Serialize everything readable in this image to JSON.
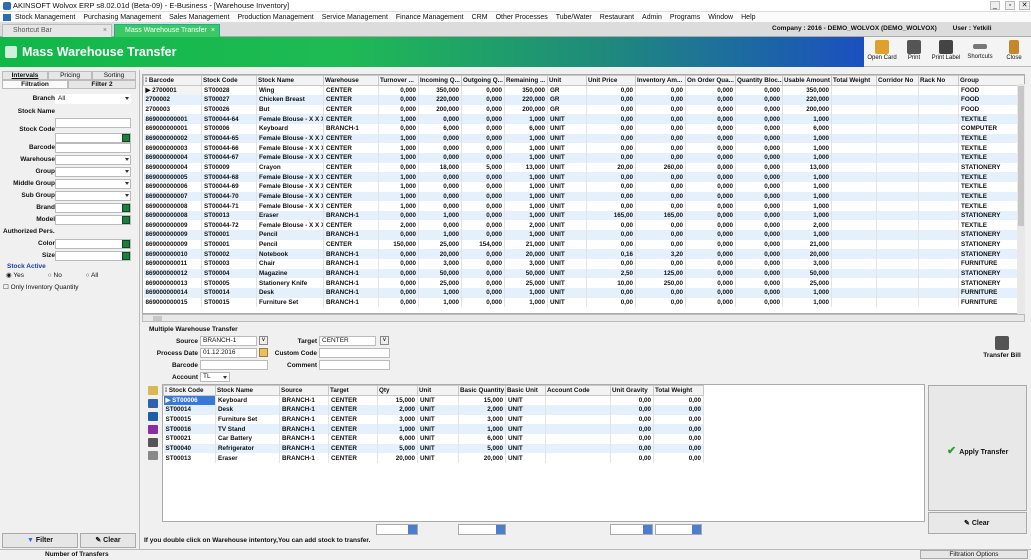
{
  "window": {
    "title": "AKINSOFT Wolvox ERP  s8.02.01d (Beta-09)  -  E-Business  -  [Warehouse Inventory]"
  },
  "menu": [
    "Stock Management",
    "Purchasing Management",
    "Sales Management",
    "Production Management",
    "Service Management",
    "Finance Management",
    "CRM",
    "Other Processes",
    "Tube/Water",
    "Restaurant",
    "Admin",
    "Programs",
    "Window",
    "Help"
  ],
  "tabs": {
    "shortcut": "Shortcut Bar",
    "active": "Mass Warehouse Transfer"
  },
  "company": {
    "label": "Company : 2016 - DEMO_WOLVOX (DEMO_WOLVOX)",
    "user": "User : Yetkili"
  },
  "header": {
    "title": "Mass Warehouse Transfer"
  },
  "toolbar": {
    "open_card": "Open Card",
    "print": "Print",
    "print_label": "Print Label",
    "shortcuts": "Shortcuts",
    "close": "Close"
  },
  "left": {
    "tab_intervals": "Intervals",
    "tab_pricing": "Pricing",
    "tab_sorting": "Sorting",
    "tab_filtration": "Filtration",
    "tab_filter2": "Filter 2",
    "branch_label": "Branch",
    "branch_value": "All",
    "stock_name": "Stock Name",
    "stock_code": "Stock Code",
    "barcode": "Barcode",
    "warehouse": "Warehouse",
    "group": "Group",
    "middle_group": "Middle Group",
    "sub_group": "Sub Group",
    "brand": "Brand",
    "model": "Model",
    "authorized": "Authorized Pers.",
    "color": "Color",
    "size": "Size",
    "stock_active": "Stock Active",
    "yes": "Yes",
    "no": "No",
    "all": "All",
    "only_inventory": "Only Inventory Quantity",
    "filter_btn": "Filter",
    "clear_btn": "Clear"
  },
  "grid1": {
    "headers": [
      "Barcode",
      "Stock Code",
      "Stock Name",
      "Warehouse",
      "Turnover ...",
      "Incoming Q...",
      "Outgoing Q...",
      "Remaining ...",
      "Unit",
      "Unit Price",
      "Inventory Am...",
      "On Order Qua...",
      "Quantity Bloc...",
      "Usable Amount",
      "Total Weight",
      "Corridor No",
      "Rack No",
      "Group"
    ],
    "rows": [
      [
        "2700001",
        "ST00028",
        "Wing",
        "CENTER",
        "0,000",
        "350,000",
        "0,000",
        "350,000",
        "GR",
        "0,00",
        "0,00",
        "0,000",
        "0,000",
        "350,000",
        "",
        "",
        "",
        "FOOD"
      ],
      [
        "2700002",
        "ST00027",
        "Chicken Breast",
        "CENTER",
        "0,000",
        "220,000",
        "0,000",
        "220,000",
        "GR",
        "0,00",
        "0,00",
        "0,000",
        "0,000",
        "220,000",
        "",
        "",
        "",
        "FOOD"
      ],
      [
        "2700003",
        "ST00026",
        "But",
        "CENTER",
        "0,000",
        "200,000",
        "0,000",
        "200,000",
        "GR",
        "0,00",
        "0,00",
        "0,000",
        "0,000",
        "200,000",
        "",
        "",
        "",
        "FOOD"
      ],
      [
        "869000000001",
        "ST00044-64",
        "Female Blouse - X X X",
        "CENTER",
        "1,000",
        "0,000",
        "0,000",
        "1,000",
        "UNIT",
        "0,00",
        "0,00",
        "0,000",
        "0,000",
        "1,000",
        "",
        "",
        "",
        "TEXTILE"
      ],
      [
        "869000000001",
        "ST00006",
        "Keyboard",
        "BRANCH-1",
        "0,000",
        "6,000",
        "0,000",
        "6,000",
        "UNIT",
        "0,00",
        "0,00",
        "0,000",
        "0,000",
        "6,000",
        "",
        "",
        "",
        "COMPUTER"
      ],
      [
        "869000000002",
        "ST00044-65",
        "Female Blouse - X X X",
        "CENTER",
        "1,000",
        "0,000",
        "0,000",
        "1,000",
        "UNIT",
        "0,00",
        "0,00",
        "0,000",
        "0,000",
        "1,000",
        "",
        "",
        "",
        "TEXTILE"
      ],
      [
        "869000000003",
        "ST00044-66",
        "Female Blouse - X X X",
        "CENTER",
        "1,000",
        "0,000",
        "0,000",
        "1,000",
        "UNIT",
        "0,00",
        "0,00",
        "0,000",
        "0,000",
        "1,000",
        "",
        "",
        "",
        "TEXTILE"
      ],
      [
        "869000000004",
        "ST00044-67",
        "Female Blouse - X X X",
        "CENTER",
        "1,000",
        "0,000",
        "0,000",
        "1,000",
        "UNIT",
        "0,00",
        "0,00",
        "0,000",
        "0,000",
        "1,000",
        "",
        "",
        "",
        "TEXTILE"
      ],
      [
        "869000000004",
        "ST00009",
        "Crayon",
        "CENTER",
        "0,000",
        "18,000",
        "5,000",
        "13,000",
        "UNIT",
        "20,00",
        "260,00",
        "0,000",
        "0,000",
        "13,000",
        "",
        "",
        "",
        "STATIONERY"
      ],
      [
        "869000000005",
        "ST00044-68",
        "Female Blouse - X X X",
        "CENTER",
        "1,000",
        "0,000",
        "0,000",
        "1,000",
        "UNIT",
        "0,00",
        "0,00",
        "0,000",
        "0,000",
        "1,000",
        "",
        "",
        "",
        "TEXTILE"
      ],
      [
        "869000000006",
        "ST00044-69",
        "Female Blouse - X X X",
        "CENTER",
        "1,000",
        "0,000",
        "0,000",
        "1,000",
        "UNIT",
        "0,00",
        "0,00",
        "0,000",
        "0,000",
        "1,000",
        "",
        "",
        "",
        "TEXTILE"
      ],
      [
        "869000000007",
        "ST00044-70",
        "Female Blouse - X X X",
        "CENTER",
        "1,000",
        "0,000",
        "0,000",
        "1,000",
        "UNIT",
        "0,00",
        "0,00",
        "0,000",
        "0,000",
        "1,000",
        "",
        "",
        "",
        "TEXTILE"
      ],
      [
        "869000000008",
        "ST00044-71",
        "Female Blouse - X X X",
        "CENTER",
        "1,000",
        "0,000",
        "0,000",
        "1,000",
        "UNIT",
        "0,00",
        "0,00",
        "0,000",
        "0,000",
        "1,000",
        "",
        "",
        "",
        "TEXTILE"
      ],
      [
        "869000000008",
        "ST00013",
        "Eraser",
        "BRANCH-1",
        "0,000",
        "1,000",
        "0,000",
        "1,000",
        "UNIT",
        "165,00",
        "165,00",
        "0,000",
        "0,000",
        "1,000",
        "",
        "",
        "",
        "STATIONERY"
      ],
      [
        "869000000009",
        "ST00044-72",
        "Female Blouse - X X X",
        "CENTER",
        "2,000",
        "0,000",
        "0,000",
        "2,000",
        "UNIT",
        "0,00",
        "0,00",
        "0,000",
        "0,000",
        "2,000",
        "",
        "",
        "",
        "TEXTILE"
      ],
      [
        "869000000009",
        "ST00001",
        "Pencil",
        "BRANCH-1",
        "0,000",
        "1,000",
        "0,000",
        "1,000",
        "UNIT",
        "0,00",
        "0,00",
        "0,000",
        "0,000",
        "1,000",
        "",
        "",
        "",
        "STATIONERY"
      ],
      [
        "869000000009",
        "ST00001",
        "Pencil",
        "CENTER",
        "150,000",
        "25,000",
        "154,000",
        "21,000",
        "UNIT",
        "0,00",
        "0,00",
        "0,000",
        "0,000",
        "21,000",
        "",
        "",
        "",
        "STATIONERY"
      ],
      [
        "869000000010",
        "ST00002",
        "Notebook",
        "BRANCH-1",
        "0,000",
        "20,000",
        "0,000",
        "20,000",
        "UNIT",
        "0,16",
        "3,20",
        "0,000",
        "0,000",
        "20,000",
        "",
        "",
        "",
        "STATIONERY"
      ],
      [
        "869000000011",
        "ST00003",
        "Chair",
        "BRANCH-1",
        "0,000",
        "3,000",
        "0,000",
        "3,000",
        "UNIT",
        "0,00",
        "0,00",
        "0,000",
        "0,000",
        "3,000",
        "",
        "",
        "",
        "FURNITURE"
      ],
      [
        "869000000012",
        "ST00004",
        "Magazine",
        "BRANCH-1",
        "0,000",
        "50,000",
        "0,000",
        "50,000",
        "UNIT",
        "2,50",
        "125,00",
        "0,000",
        "0,000",
        "50,000",
        "",
        "",
        "",
        "STATIONERY"
      ],
      [
        "869000000013",
        "ST00005",
        "Stationery Knife",
        "BRANCH-1",
        "0,000",
        "25,000",
        "0,000",
        "25,000",
        "UNIT",
        "10,00",
        "250,00",
        "0,000",
        "0,000",
        "25,000",
        "",
        "",
        "",
        "STATIONERY"
      ],
      [
        "869000000014",
        "ST00014",
        "Desk",
        "BRANCH-1",
        "0,000",
        "1,000",
        "0,000",
        "1,000",
        "UNIT",
        "0,00",
        "0,00",
        "0,000",
        "0,000",
        "1,000",
        "",
        "",
        "",
        "FURNITURE"
      ],
      [
        "869000000015",
        "ST00015",
        "Furniture Set",
        "BRANCH-1",
        "0,000",
        "1,000",
        "0,000",
        "1,000",
        "UNIT",
        "0,00",
        "0,00",
        "0,000",
        "0,000",
        "1,000",
        "",
        "",
        "",
        "FURNITURE"
      ]
    ]
  },
  "form": {
    "section_title": "Multiple Warehouse Transfer",
    "source_label": "Source",
    "source_value": "BRANCH-1",
    "target_label": "Target",
    "target_value": "CENTER",
    "date_label": "Process Date",
    "date_value": "01.12.2016",
    "custom_code_label": "Custom Code",
    "barcode_label": "Barcode",
    "comment_label": "Comment",
    "account_label": "Account",
    "account_value": "TL",
    "transfer_bill": "Transfer Bill"
  },
  "grid2": {
    "headers": [
      "Stock Code",
      "Stock Name",
      "Source",
      "Target",
      "Qty",
      "Unit",
      "Basic Quantity",
      "Basic Unit",
      "Account Code",
      "Unit Gravity",
      "Total Weight"
    ],
    "rows": [
      [
        "ST00006",
        "Keyboard",
        "BRANCH-1",
        "CENTER",
        "15,000",
        "UNIT",
        "15,000",
        "UNIT",
        "",
        "0,00",
        "0,00"
      ],
      [
        "ST00014",
        "Desk",
        "BRANCH-1",
        "CENTER",
        "2,000",
        "UNIT",
        "2,000",
        "UNIT",
        "",
        "0,00",
        "0,00"
      ],
      [
        "ST00015",
        "Furniture Set",
        "BRANCH-1",
        "CENTER",
        "3,000",
        "UNIT",
        "3,000",
        "UNIT",
        "",
        "0,00",
        "0,00"
      ],
      [
        "ST00016",
        "TV Stand",
        "BRANCH-1",
        "CENTER",
        "1,000",
        "UNIT",
        "1,000",
        "UNIT",
        "",
        "0,00",
        "0,00"
      ],
      [
        "ST00021",
        "Car Battery",
        "BRANCH-1",
        "CENTER",
        "6,000",
        "UNIT",
        "6,000",
        "UNIT",
        "",
        "0,00",
        "0,00"
      ],
      [
        "ST00040",
        "Refrigerator",
        "BRANCH-1",
        "CENTER",
        "5,000",
        "UNIT",
        "5,000",
        "UNIT",
        "",
        "0,00",
        "0,00"
      ],
      [
        "ST00013",
        "Eraser",
        "BRANCH-1",
        "CENTER",
        "20,000",
        "UNIT",
        "20,000",
        "UNIT",
        "",
        "0,00",
        "0,00"
      ]
    ]
  },
  "apply_transfer": "Apply Transfer",
  "clear": "Clear",
  "hint": "If you double click on Warehouse intentory,You can add stock to transfer.",
  "status": {
    "left": "Number of Transfers",
    "right": "Filtration Options"
  }
}
